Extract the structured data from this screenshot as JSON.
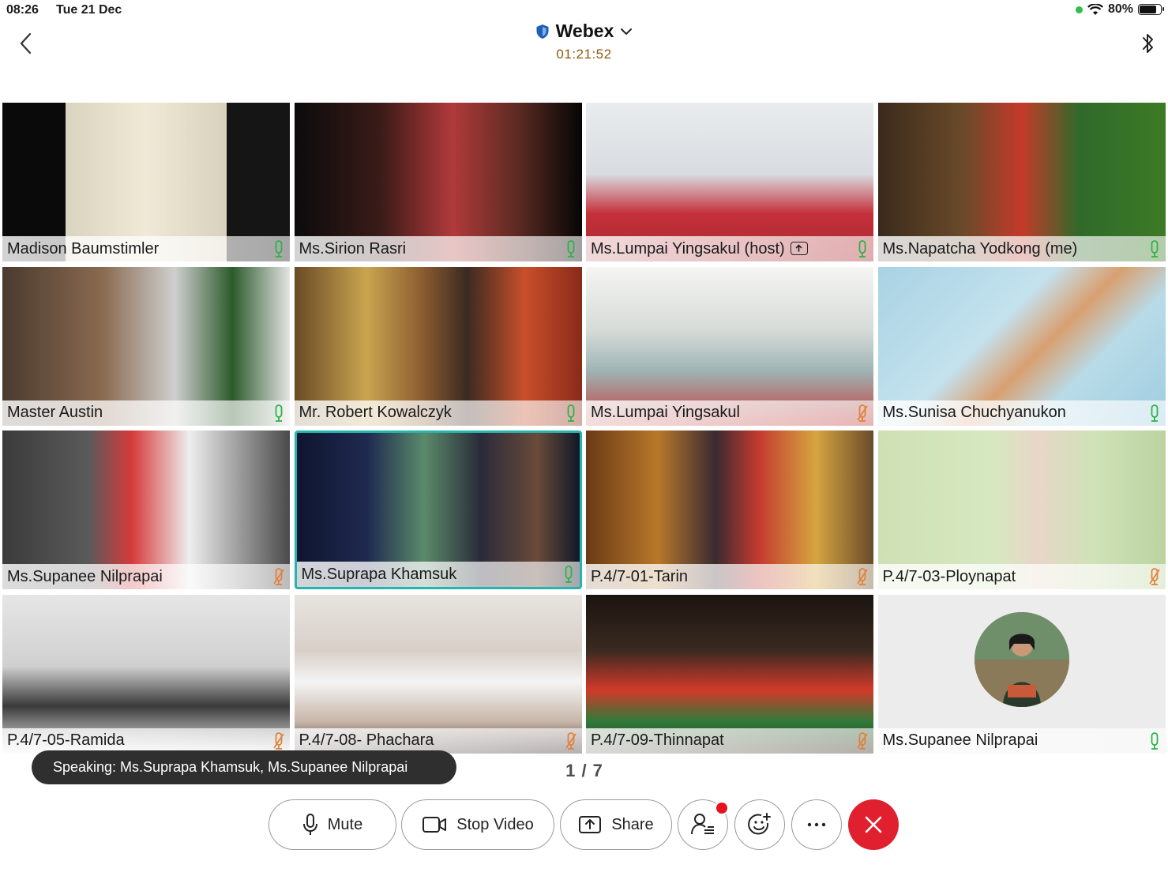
{
  "status_bar": {
    "time": "08:26",
    "date": "Tue 21 Dec",
    "battery": "80%",
    "battery_level": 0.8
  },
  "header": {
    "title": "Webex",
    "timer": "01:21:52"
  },
  "participants": [
    {
      "name": "Madison Baumstimler",
      "mic": "on",
      "bg": "linear-gradient(90deg,#0a0a0a 0%,#0a0a0a 22%,#d9d4bf 22%,#efe9d6 50%,#d8d1bd 78%,#151515 78%)"
    },
    {
      "name": "Ms.Sirion Rasri",
      "mic": "on",
      "bg": "linear-gradient(90deg,#0b0b0b 0%,#3a1b18 30%,#b03a3a 55%,#5a2a22 78%,#050505 100%)"
    },
    {
      "name": "Ms.Lumpai Yingsakul (host)",
      "mic": "on",
      "host": true,
      "bg": "linear-gradient(180deg,#e9ecef 0%,#d8dce0 45%,#c4303a 70%,#a82a30 100%)"
    },
    {
      "name": "Ms.Napatcha Yodkong (me)",
      "mic": "on",
      "bg": "linear-gradient(90deg,#3a2a1c 0%,#6b4a2a 30%,#c43a2a 50%,#2f6a2a 70%,#3d7a25 100%)"
    },
    {
      "name": "Master Austin",
      "mic": "on",
      "bg": "linear-gradient(90deg,#4a3a30 0%,#8a6a50 35%,#cfcfcf 60%,#2c5a2c 80%,#e4e4e4 100%)"
    },
    {
      "name": "Mr. Robert Kowalczyk",
      "mic": "on",
      "bg": "linear-gradient(90deg,#6a4a25 0%,#c9a550 25%,#8a5a30 45%,#3a2a22 60%,#c8502a 80%,#8a2a1a 100%)"
    },
    {
      "name": "Ms.Lumpai Yingsakul",
      "mic": "muted",
      "bg": "linear-gradient(180deg,#f5f5f2 0%,#d6dbd8 40%,#9fb5b5 65%,#c43a3a 100%)"
    },
    {
      "name": "Ms.Sunisa Chuchyanukon",
      "mic": "on",
      "bg": "linear-gradient(135deg,#a9d2e3 0%,#c4e2ee 40%,#d8a070 55%,#b8dbe8 70%,#9fcde0 100%)"
    },
    {
      "name": "Ms.Supanee Nilprapai",
      "mic": "muted",
      "bg": "linear-gradient(90deg,#3b3b3b 0%,#5a5a5a 30%,#d63a3a 45%,#eeeeee 65%,#4a4a4a 100%)"
    },
    {
      "name": "Ms.Suprapa Khamsuk",
      "mic": "on",
      "active": true,
      "bg": "linear-gradient(90deg,#0f1530 0%,#1f2a50 25%,#5a8a6a 45%,#2a2a3a 65%,#6a4a3a 85%,#101828 100%)"
    },
    {
      "name": "P.4/7-01-Tarin",
      "mic": "muted",
      "bg": "linear-gradient(90deg,#6a3a15 0%,#b8782a 25%,#3a2a30 45%,#c33a30 60%,#d5a540 80%,#6a4a2a 100%)"
    },
    {
      "name": "P.4/7-03-Ploynapat",
      "mic": "muted",
      "bg": "linear-gradient(90deg,#cfe0b5 0%,#d6e8c0 40%,#e8d6c8 55%,#cfe2b8 75%,#bcd3a0 100%)"
    },
    {
      "name": "P.4/7-05-Ramida",
      "mic": "muted",
      "bg": "linear-gradient(180deg,#e6e6e6 0%,#d0d0d0 45%,#3a3a3a 70%,#f0f0f0 100%)"
    },
    {
      "name": "P.4/7-08- Phachara",
      "mic": "muted",
      "bg": "linear-gradient(180deg,#e7e4e0 0%,#d8cfc8 35%,#f4f4f4 55%,#c7b5a8 80%,#3a3030 100%)"
    },
    {
      "name": "P.4/7-09-Thinnapat",
      "mic": "muted",
      "bg": "linear-gradient(180deg,#1a1410 0%,#3a2a20 35%,#d23a2a 60%,#2f7a3a 80%,#3a2a20 100%)"
    },
    {
      "name": "Ms.Supanee Nilprapai",
      "mic": "on",
      "avatar": true,
      "bg": "#ececec"
    }
  ],
  "speaking_toast": "Speaking: Ms.Suprapa Khamsuk, Ms.Supanee Nilprapai",
  "page_indicator": "1 / 7",
  "controls": {
    "mute": "Mute",
    "stop_video": "Stop Video",
    "share": "Share"
  },
  "colors": {
    "active_border": "#25b5ad",
    "end_call": "#e0202e",
    "mic_on": "#2db34a",
    "mic_muted": "#e2823a",
    "timer": "#8b5a10"
  }
}
